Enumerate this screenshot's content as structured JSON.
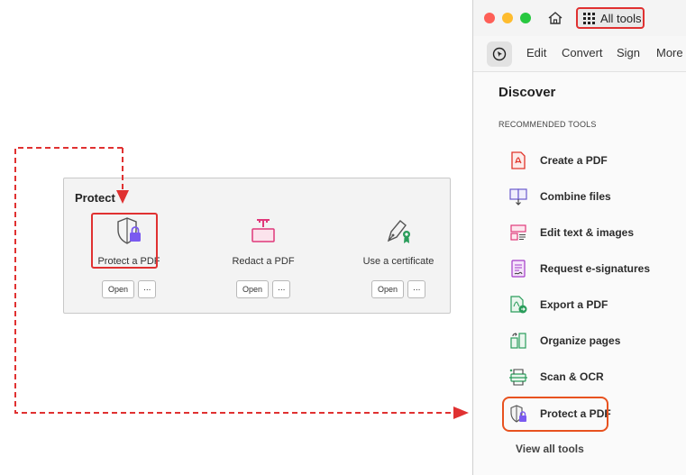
{
  "protect_panel": {
    "title": "Protect",
    "tools": [
      {
        "label": "Protect a PDF",
        "open": "Open",
        "more": "···",
        "icon": "shield-lock-icon"
      },
      {
        "label": "Redact a PDF",
        "open": "Open",
        "more": "···",
        "icon": "redact-icon"
      },
      {
        "label": "Use a certificate",
        "open": "Open",
        "more": "···",
        "icon": "certificate-pen-icon"
      }
    ]
  },
  "window": {
    "title_bar": {
      "all_tools": "All tools"
    },
    "menu": {
      "edit": "Edit",
      "convert": "Convert",
      "sign": "Sign",
      "more": "More"
    },
    "discover": "Discover",
    "discover_extra": ":",
    "section_label": "RECOMMENDED TOOLS",
    "recommended_tools": [
      {
        "label": "Create a PDF",
        "icon": "create-pdf-icon"
      },
      {
        "label": "Combine files",
        "icon": "combine-files-icon"
      },
      {
        "label": "Edit text & images",
        "icon": "edit-text-icon"
      },
      {
        "label": "Request e-signatures",
        "icon": "e-signature-icon"
      },
      {
        "label": "Export a PDF",
        "icon": "export-pdf-icon"
      },
      {
        "label": "Organize pages",
        "icon": "organize-pages-icon"
      },
      {
        "label": "Scan & OCR",
        "icon": "scan-ocr-icon"
      },
      {
        "label": "Protect a PDF",
        "icon": "protect-pdf-icon"
      }
    ],
    "view_all": "View all tools"
  },
  "colors": {
    "highlight_red": "#e03131",
    "highlight_orange": "#e8521f",
    "acrobat_red": "#e0342a",
    "purple": "#7a5af0",
    "magenta": "#e0387a",
    "green": "#2a9d5b"
  }
}
